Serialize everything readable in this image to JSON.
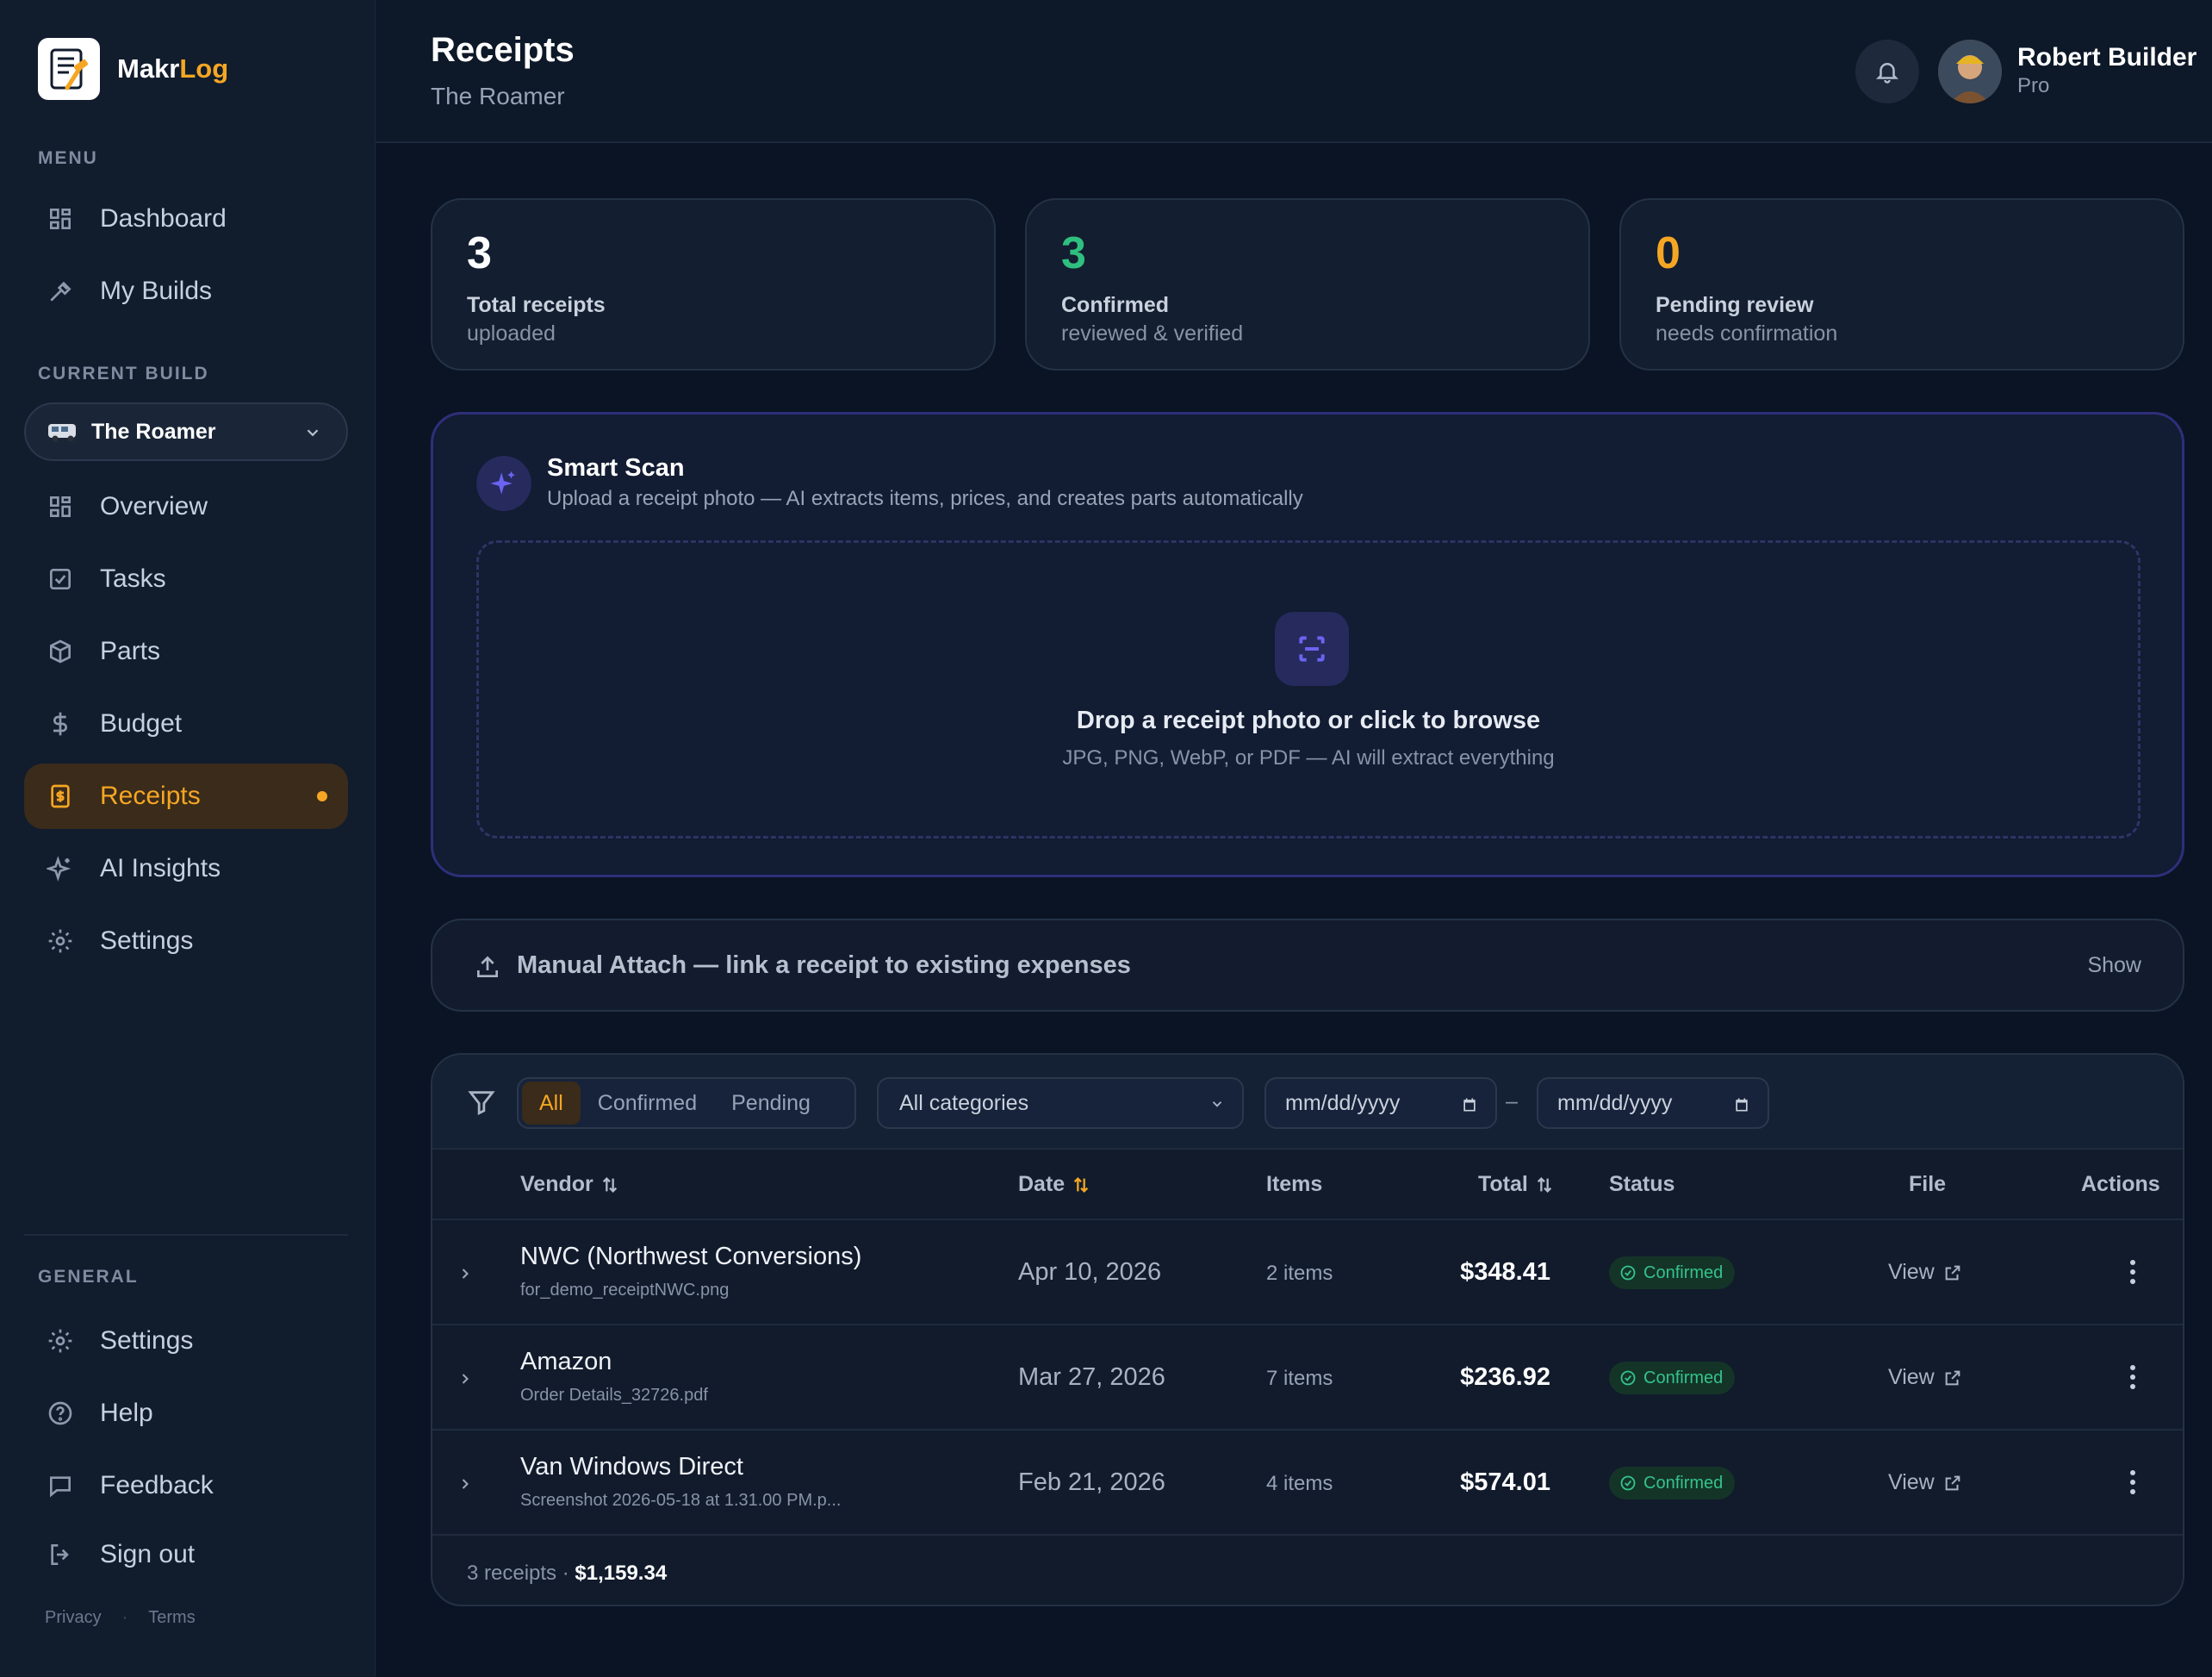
{
  "brand": {
    "name_main": "Makr",
    "name_accent": "Log"
  },
  "sidebar": {
    "menu_label": "MENU",
    "menu_items": [
      {
        "label": "Dashboard",
        "icon": "grid-icon"
      },
      {
        "label": "My Builds",
        "icon": "hammer-icon"
      }
    ],
    "current_build_label": "CURRENT BUILD",
    "current_build": "The Roamer",
    "build_items": [
      {
        "label": "Overview",
        "icon": "grid-icon"
      },
      {
        "label": "Tasks",
        "icon": "checkbox-icon"
      },
      {
        "label": "Parts",
        "icon": "box-icon"
      },
      {
        "label": "Budget",
        "icon": "dollar-icon"
      },
      {
        "label": "Receipts",
        "icon": "receipt-icon",
        "active": true
      },
      {
        "label": "AI Insights",
        "icon": "sparkle-icon"
      },
      {
        "label": "Settings",
        "icon": "gear-icon"
      }
    ],
    "general_label": "GENERAL",
    "general_items": [
      {
        "label": "Settings",
        "icon": "gear-icon"
      },
      {
        "label": "Help",
        "icon": "help-icon"
      },
      {
        "label": "Feedback",
        "icon": "chat-icon"
      },
      {
        "label": "Sign out",
        "icon": "logout-icon"
      }
    ],
    "footer": {
      "privacy": "Privacy",
      "terms": "Terms"
    }
  },
  "header": {
    "title": "Receipts",
    "subtitle": "The Roamer",
    "user_name": "Robert Builder",
    "user_plan": "Pro"
  },
  "stats": [
    {
      "value": "3",
      "label": "Total receipts",
      "sub": "uploaded",
      "color": "#ffffff"
    },
    {
      "value": "3",
      "label": "Confirmed",
      "sub": "reviewed & verified",
      "color": "#2fbf7f"
    },
    {
      "value": "0",
      "label": "Pending review",
      "sub": "needs confirmation",
      "color": "#f5a623"
    }
  ],
  "smart_scan": {
    "title": "Smart Scan",
    "description": "Upload a receipt photo — AI extracts items, prices, and creates parts automatically",
    "drop_title": "Drop a receipt photo or click to browse",
    "drop_sub": "JPG, PNG, WebP, or PDF — AI will extract everything"
  },
  "manual_attach": {
    "label": "Manual Attach — link a receipt to existing expenses",
    "toggle": "Show"
  },
  "filters": {
    "segments": [
      "All",
      "Confirmed",
      "Pending"
    ],
    "active_segment": "All",
    "category": "All categories",
    "date_from_placeholder": "mm/dd/yyyy",
    "date_to_placeholder": "mm/dd/yyyy",
    "date_separator": "–"
  },
  "table": {
    "columns": {
      "vendor": "Vendor",
      "date": "Date",
      "items": "Items",
      "total": "Total",
      "status": "Status",
      "file": "File",
      "actions": "Actions"
    },
    "rows": [
      {
        "vendor": "NWC (Northwest Conversions)",
        "file": "for_demo_receiptNWC.png",
        "date": "Apr 10, 2026",
        "items": "2 items",
        "total": "$348.41",
        "status": "Confirmed",
        "file_action": "View"
      },
      {
        "vendor": "Amazon",
        "file": "Order Details_32726.pdf",
        "date": "Mar 27, 2026",
        "items": "7 items",
        "total": "$236.92",
        "status": "Confirmed",
        "file_action": "View"
      },
      {
        "vendor": "Van Windows Direct",
        "file": "Screenshot 2026-05-18 at 1.31.00 PM.p...",
        "date": "Feb 21, 2026",
        "items": "4 items",
        "total": "$574.01",
        "status": "Confirmed",
        "file_action": "View"
      }
    ],
    "footer_count": "3 receipts ·",
    "footer_total": "$1,159.34"
  }
}
